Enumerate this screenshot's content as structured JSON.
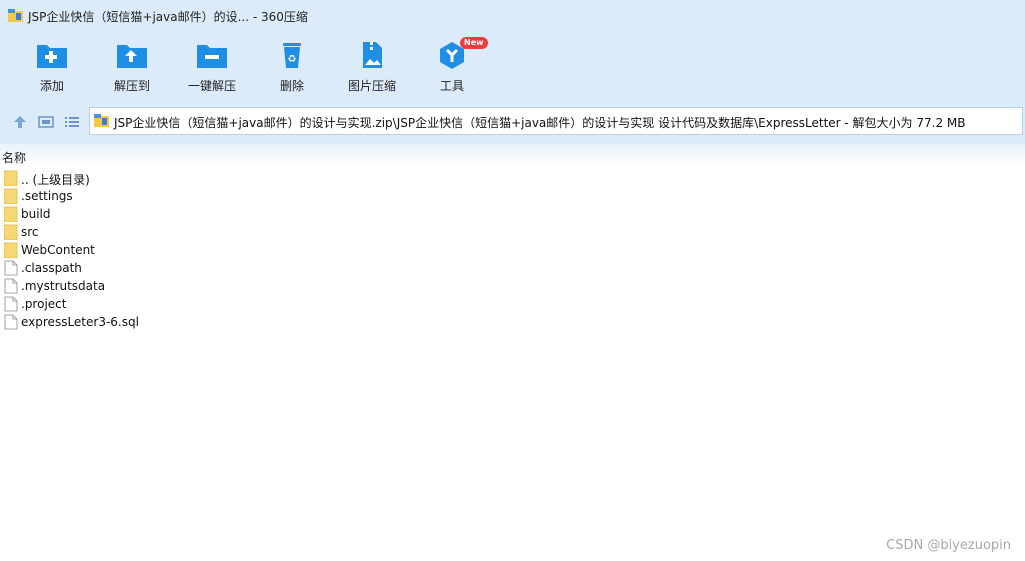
{
  "window": {
    "title": "JSP企业快信（短信猫+java邮件）的设... - 360压缩"
  },
  "toolbar": {
    "items": [
      {
        "label": "添加",
        "icon": "add-folder-icon"
      },
      {
        "label": "解压到",
        "icon": "extract-to-icon"
      },
      {
        "label": "一键解压",
        "icon": "one-click-extract-icon"
      },
      {
        "label": "删除",
        "icon": "recycle-bin-icon"
      },
      {
        "label": "图片压缩",
        "icon": "image-compress-icon"
      },
      {
        "label": "工具",
        "icon": "tools-icon",
        "badge": "New"
      }
    ]
  },
  "address": {
    "path": "JSP企业快信（短信猫+java邮件）的设计与实现.zip\\JSP企业快信（短信猫+java邮件）的设计与实现 设计代码及数据库\\ExpressLetter - 解包大小为 77.2 MB"
  },
  "list": {
    "column_name": "名称",
    "items": [
      {
        "name": ".. (上级目录)",
        "type": "folder"
      },
      {
        "name": ".settings",
        "type": "folder"
      },
      {
        "name": "build",
        "type": "folder"
      },
      {
        "name": "src",
        "type": "folder"
      },
      {
        "name": "WebContent",
        "type": "folder"
      },
      {
        "name": ".classpath",
        "type": "file"
      },
      {
        "name": ".mystrutsdata",
        "type": "file"
      },
      {
        "name": ".project",
        "type": "file"
      },
      {
        "name": "expressLeter3-6.sql",
        "type": "file"
      }
    ]
  },
  "watermark": "CSDN @biyezuopin",
  "colors": {
    "chrome_bg": "#dcebfa",
    "accent_blue": "#1f8fe6",
    "folder_yellow": "#f7d774",
    "badge_red": "#ef3b3b"
  }
}
